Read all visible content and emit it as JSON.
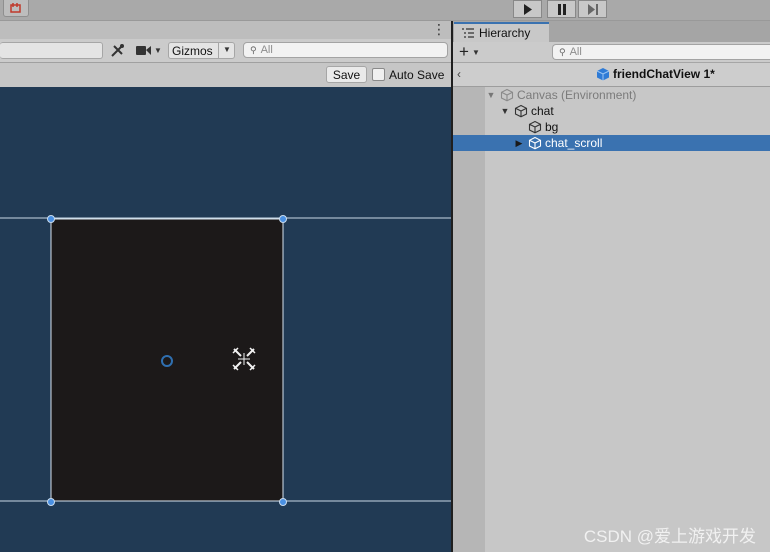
{
  "toolbar": {
    "play_icon": "play-icon",
    "pause_icon": "pause-icon",
    "step_icon": "step-icon"
  },
  "scene": {
    "gizmos_label": "Gizmos",
    "search_placeholder": "All",
    "save_label": "Save",
    "auto_save_label": "Auto Save",
    "auto_save_checked": false,
    "canvas_color": "#213a54",
    "rect_color": "#1c1919"
  },
  "hierarchy": {
    "tab_label": "Hierarchy",
    "search_placeholder": "All",
    "prefab_title": "friendChatView 1*",
    "items": [
      {
        "label": "Canvas (Environment)",
        "dimmed": true,
        "expanded": true
      },
      {
        "label": "chat",
        "dimmed": false,
        "expanded": true
      },
      {
        "label": "bg",
        "dimmed": false
      },
      {
        "label": "chat_scroll",
        "dimmed": false,
        "selected": true,
        "expanded": false
      }
    ],
    "accent_color": "#3a72b0"
  },
  "watermark": "CSDN @爱上游戏开发"
}
